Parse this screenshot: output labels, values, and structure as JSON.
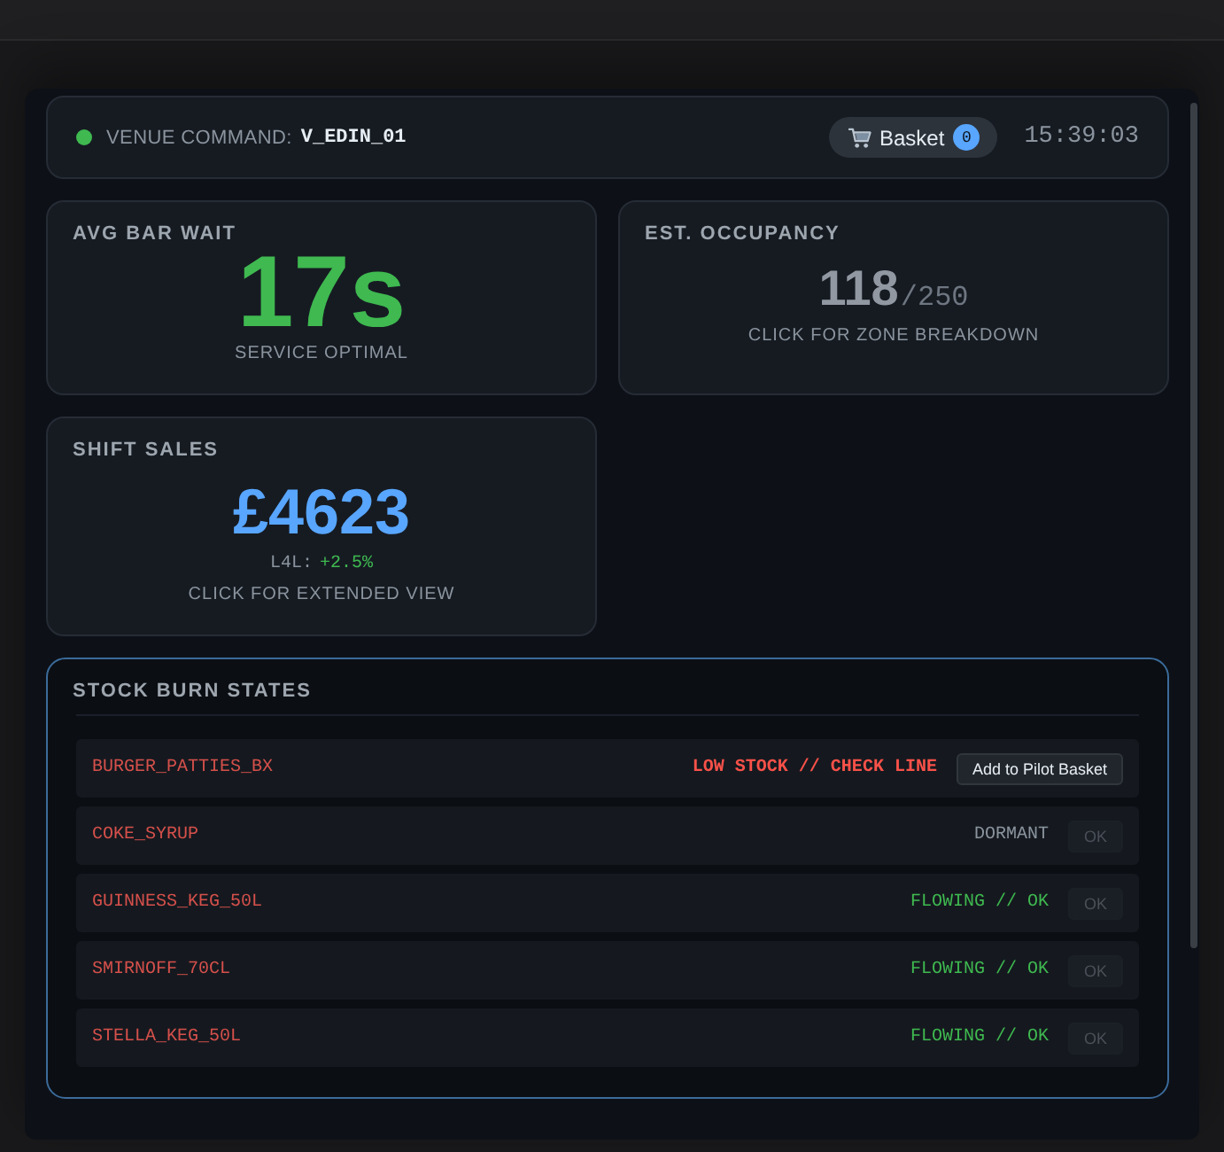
{
  "header": {
    "online": true,
    "label": "VENUE COMMAND:",
    "venue_id": "V_EDIN_01",
    "basket": {
      "label": "Basket",
      "count": "0"
    },
    "clock": "15:39:03"
  },
  "metrics": [
    {
      "kind": "value",
      "color": "#3fb950",
      "title": "AVG BAR WAIT",
      "value": "17s",
      "caption": "SERVICE OPTIMAL"
    },
    {
      "kind": "ratio",
      "color": "#9198a1",
      "title": "EST. OCCUPANCY",
      "value": "118",
      "total": "/250",
      "caption": "CLICK FOR ZONE BREAKDOWN"
    },
    {
      "kind": "sales",
      "color": "#58a6ff",
      "title": "SHIFT SALES",
      "value": "£4623",
      "delta_label": "L4L:",
      "delta": "+2.5%",
      "caption": "CLICK FOR EXTENDED VIEW"
    }
  ],
  "stock": {
    "title": "STOCK BURN STATES",
    "items": [
      {
        "name": "BURGER_PATTIES_BX",
        "kind": "low",
        "status": "LOW STOCK // CHECK LINE",
        "action": {
          "label": "Add to Pilot Basket",
          "disabled": false
        }
      },
      {
        "name": "COKE_SYRUP",
        "kind": "dormant",
        "status": "DORMANT",
        "action": {
          "label": "OK",
          "disabled": true
        }
      },
      {
        "name": "GUINNESS_KEG_50L",
        "kind": "flowing",
        "status": "FLOWING // OK",
        "action": {
          "label": "OK",
          "disabled": true
        }
      },
      {
        "name": "SMIRNOFF_70CL",
        "kind": "flowing",
        "status": "FLOWING // OK",
        "action": {
          "label": "OK",
          "disabled": true
        }
      },
      {
        "name": "STELLA_KEG_50L",
        "kind": "flowing",
        "status": "FLOWING // OK",
        "action": {
          "label": "OK",
          "disabled": true
        }
      }
    ]
  }
}
